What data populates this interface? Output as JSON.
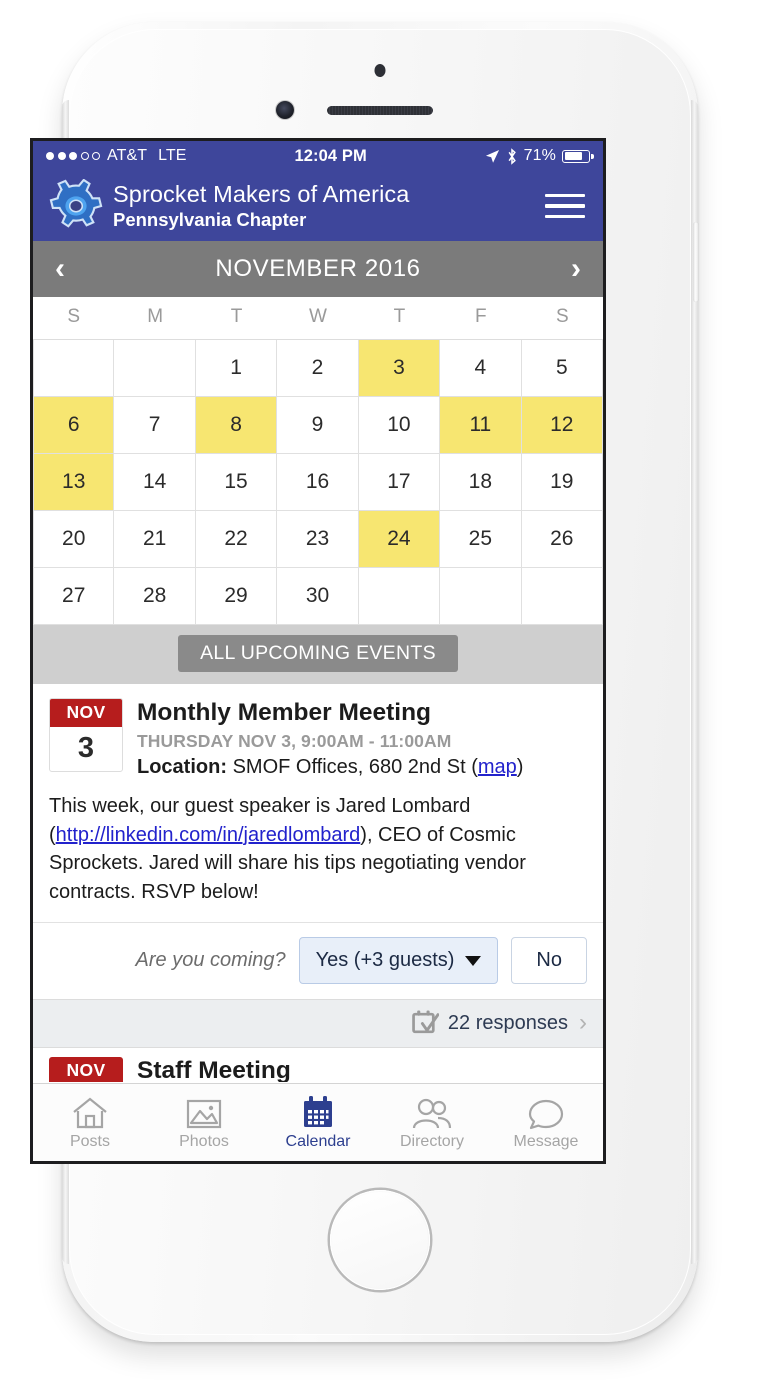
{
  "status_bar": {
    "signal_dots_filled": 3,
    "signal_dots_total": 5,
    "carrier": "AT&T",
    "network": "LTE",
    "time": "12:04 PM",
    "battery_percent": "71%",
    "location_icon": "location-arrow-icon",
    "bluetooth_icon": "bluetooth-icon"
  },
  "app_header": {
    "logo_icon": "sprocket-gear-logo",
    "title": "Sprocket Makers of America",
    "subtitle": "Pennsylvania Chapter",
    "menu_icon": "hamburger-menu-icon",
    "background_color": "#3e469b"
  },
  "month_nav": {
    "prev_label": "‹",
    "month_label": "NOVEMBER 2016",
    "next_label": "›",
    "background_color": "#7b7b7b"
  },
  "calendar": {
    "day_headers": [
      "S",
      "M",
      "T",
      "W",
      "T",
      "F",
      "S"
    ],
    "highlight_color": "#f7e671",
    "highlighted_days": [
      3,
      6,
      8,
      11,
      12,
      13,
      24
    ],
    "weeks": [
      [
        "",
        "",
        "1",
        "2",
        "3",
        "4",
        "5"
      ],
      [
        "6",
        "7",
        "8",
        "9",
        "10",
        "11",
        "12"
      ],
      [
        "13",
        "14",
        "15",
        "16",
        "17",
        "18",
        "19"
      ],
      [
        "20",
        "21",
        "22",
        "23",
        "24",
        "25",
        "26"
      ],
      [
        "27",
        "28",
        "29",
        "30",
        "",
        "",
        ""
      ]
    ]
  },
  "upcoming": {
    "button_label": "ALL UPCOMING EVENTS"
  },
  "event": {
    "badge_month": "NOV",
    "badge_day": "3",
    "badge_color": "#b61d1d",
    "title": "Monthly Member Meeting",
    "when": "THURSDAY NOV 3, 9:00AM - 11:00AM",
    "location_label": "Location:",
    "location_value": "SMOF Offices, 680 2nd St",
    "map_link": "map",
    "description_part1": "This week, our guest speaker is Jared Lombard (",
    "description_link": "http://linkedin.com/in/jaredlombard",
    "description_part2": "), CEO of Cosmic Sprockets. Jared will share his tips negotiating vendor contracts. RSVP below!",
    "rsvp_question": "Are you coming?",
    "rsvp_yes": "Yes (+3 guests)",
    "rsvp_no": "No",
    "responses_icon": "calendar-check-icon",
    "responses_text": "22 responses",
    "responses_chevron": "›"
  },
  "next_event_peek": {
    "badge_month": "NOV",
    "title": "Staff Meeting"
  },
  "tab_bar": {
    "active_color": "#2d3f8f",
    "inactive_color": "#a5a5a5",
    "tabs": [
      {
        "label": "Posts",
        "icon": "home-icon",
        "active": false
      },
      {
        "label": "Photos",
        "icon": "photo-icon",
        "active": false
      },
      {
        "label": "Calendar",
        "icon": "calendar-icon",
        "active": true
      },
      {
        "label": "Directory",
        "icon": "people-icon",
        "active": false
      },
      {
        "label": "Message",
        "icon": "chat-bubble-icon",
        "active": false
      }
    ]
  }
}
